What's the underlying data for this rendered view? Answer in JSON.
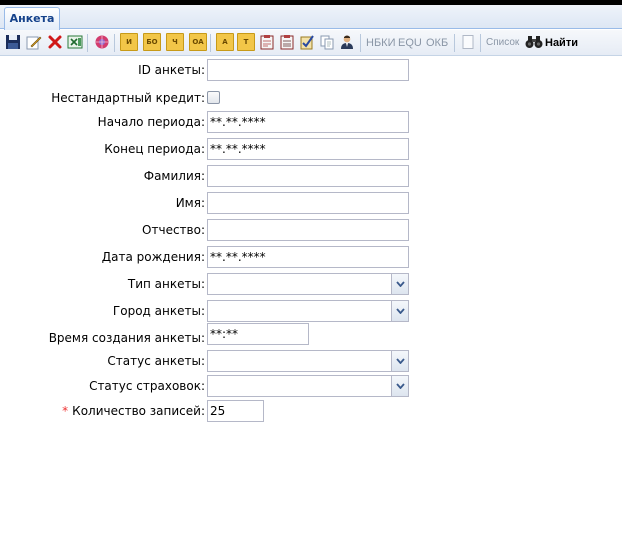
{
  "tab": {
    "label": "Анкета"
  },
  "toolbar": {
    "note_i": "И",
    "note_bo": "БО",
    "note_ch": "Ч",
    "note_oa": "ОА",
    "note_a": "А",
    "note_t": "Т",
    "nbki": "НБКИ",
    "equ": "EQU",
    "okb": "ОКБ",
    "list": "Список",
    "find": "Найти"
  },
  "form": {
    "id_label": "ID анкеты:",
    "id_value": "",
    "nonstandard_label": "Нестандартный кредит:",
    "period_start_label": "Начало периода:",
    "period_start_value": "**.**.****",
    "period_end_label": "Конец периода:",
    "period_end_value": "**.**.****",
    "lastname_label": "Фамилия:",
    "lastname_value": "",
    "firstname_label": "Имя:",
    "firstname_value": "",
    "patronymic_label": "Отчество:",
    "patronymic_value": "",
    "birthdate_label": "Дата рождения:",
    "birthdate_value": "**.**.****",
    "type_label": "Тип анкеты:",
    "type_value": "",
    "city_label": "Город анкеты:",
    "city_value": "",
    "created_time_label": "Время создания анкеты:",
    "created_time_value": "**:**",
    "status_label": "Статус анкеты:",
    "status_value": "",
    "insurance_label": "Статус страховок:",
    "insurance_value": "",
    "required_mark": "*",
    "count_label": "Количество записей:",
    "count_value": "25"
  }
}
